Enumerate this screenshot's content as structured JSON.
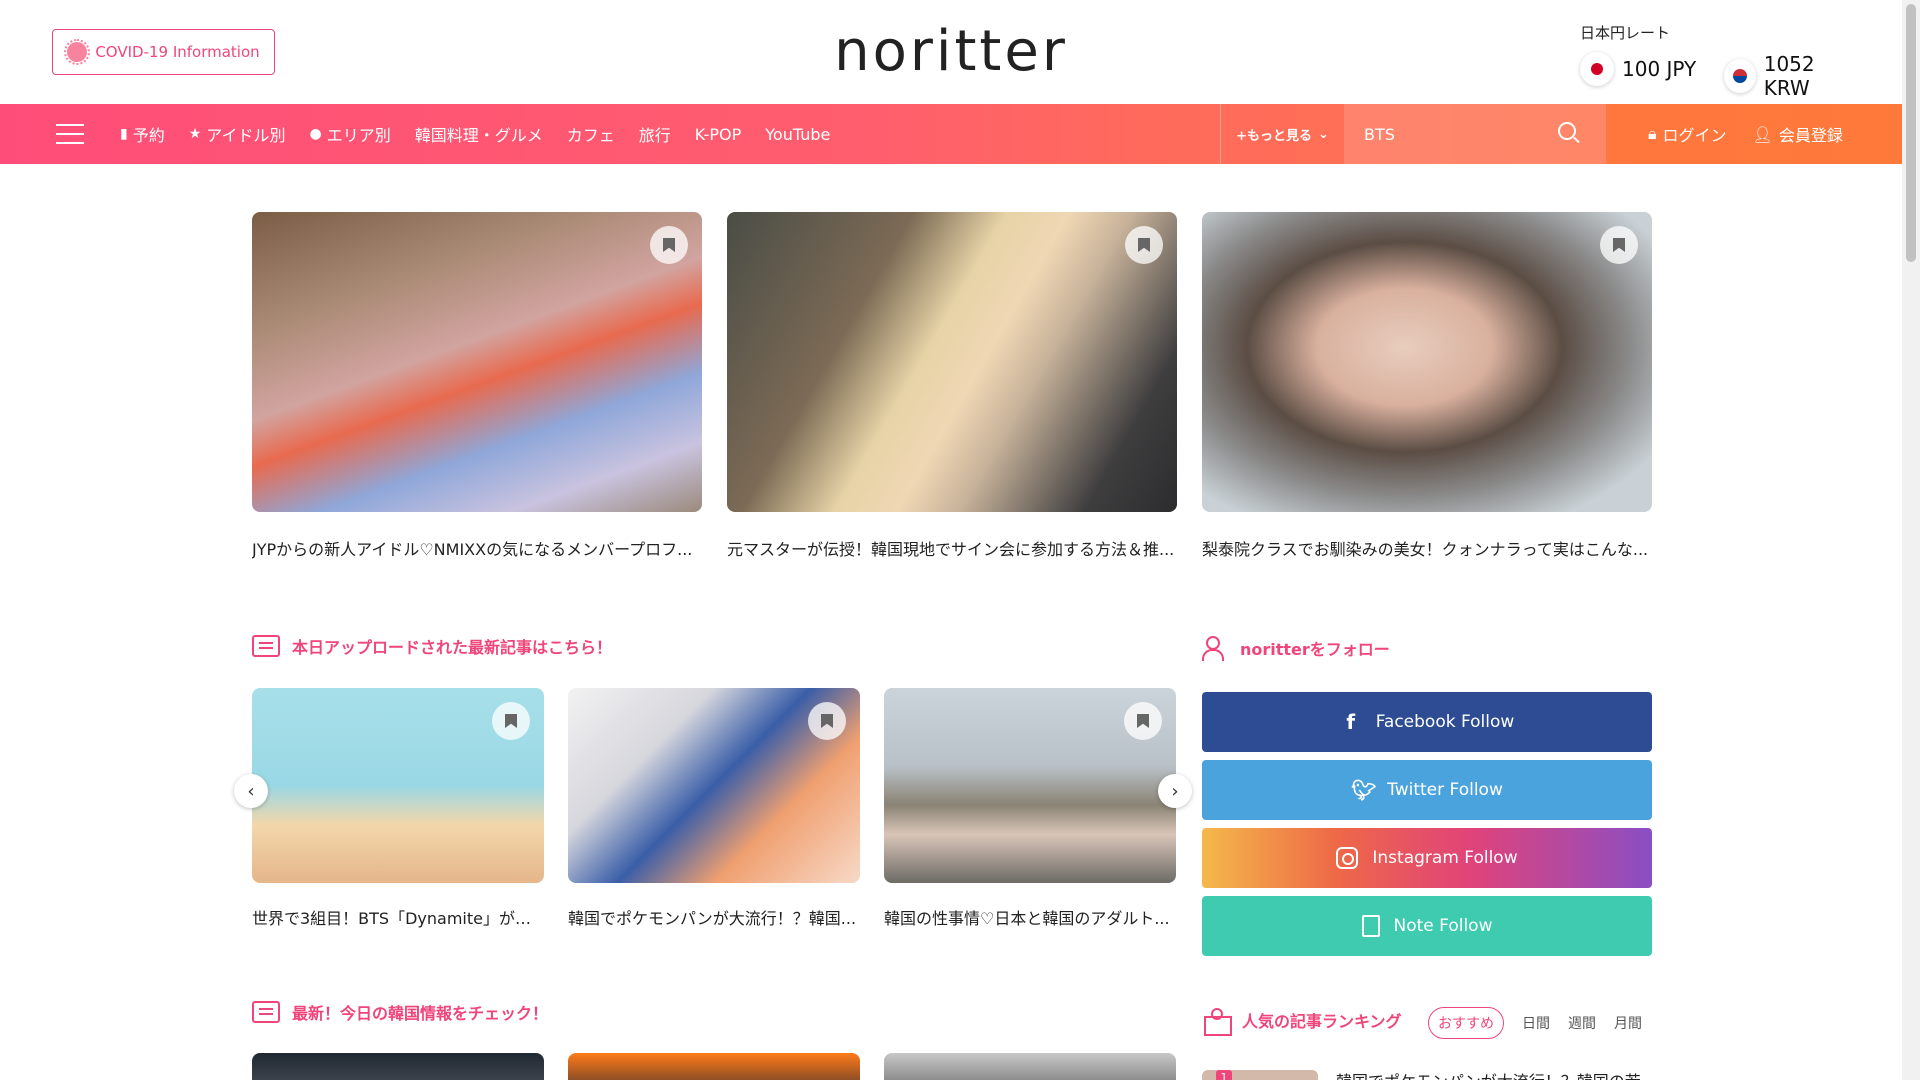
{
  "header": {
    "covid_label": "COVID-19 Information",
    "logo": "noritter",
    "rate_title": "日本円レート",
    "rate_jpy": "100 JPY",
    "rate_krw": "1052 KRW"
  },
  "nav": {
    "items": [
      "予約",
      "アイドル別",
      "エリア別",
      "韓国料理・グルメ",
      "カフェ",
      "旅行",
      "K-POP",
      "YouTube"
    ],
    "more": "+もっと見る",
    "search_value": "BTS",
    "login": "ログイン",
    "register": "会員登録"
  },
  "featured": [
    {
      "caption": "JYPからの新人アイドル♡NMIXXの気になるメンバープロフ..."
    },
    {
      "caption": "元マスターが伝授！韓国現地でサイン会に参加する方法＆推..."
    },
    {
      "caption": "梨泰院クラスでお馴染みの美女！クォンナラって実はこんな..."
    }
  ],
  "latest": {
    "heading": "本日アップロードされた最新記事はこちら！",
    "cards": [
      {
        "caption": "世界で3組目！BTS「Dynamite」がレ..."
      },
      {
        "caption": "韓国でポケモンパンが大流行！？韓国..."
      },
      {
        "caption": "韓国の性事情♡日本と韓国のアダルト..."
      }
    ]
  },
  "follow": {
    "heading": "noritterをフォロー",
    "facebook": "Facebook Follow",
    "twitter": "Twitter Follow",
    "instagram": "Instagram Follow",
    "note": "Note Follow"
  },
  "news": {
    "heading": "最新！今日の韓国情報をチェック！"
  },
  "ranking": {
    "heading": "人気の記事ランキング",
    "tabs": [
      "おすすめ",
      "日間",
      "週間",
      "月間"
    ],
    "first_rank": "1",
    "first_title": "韓国でポケモンパンが大流行！？韓国の若"
  },
  "colors": {
    "accent": "#f0457a",
    "nav_start": "#ff4d79",
    "nav_end": "#ff7b45"
  }
}
